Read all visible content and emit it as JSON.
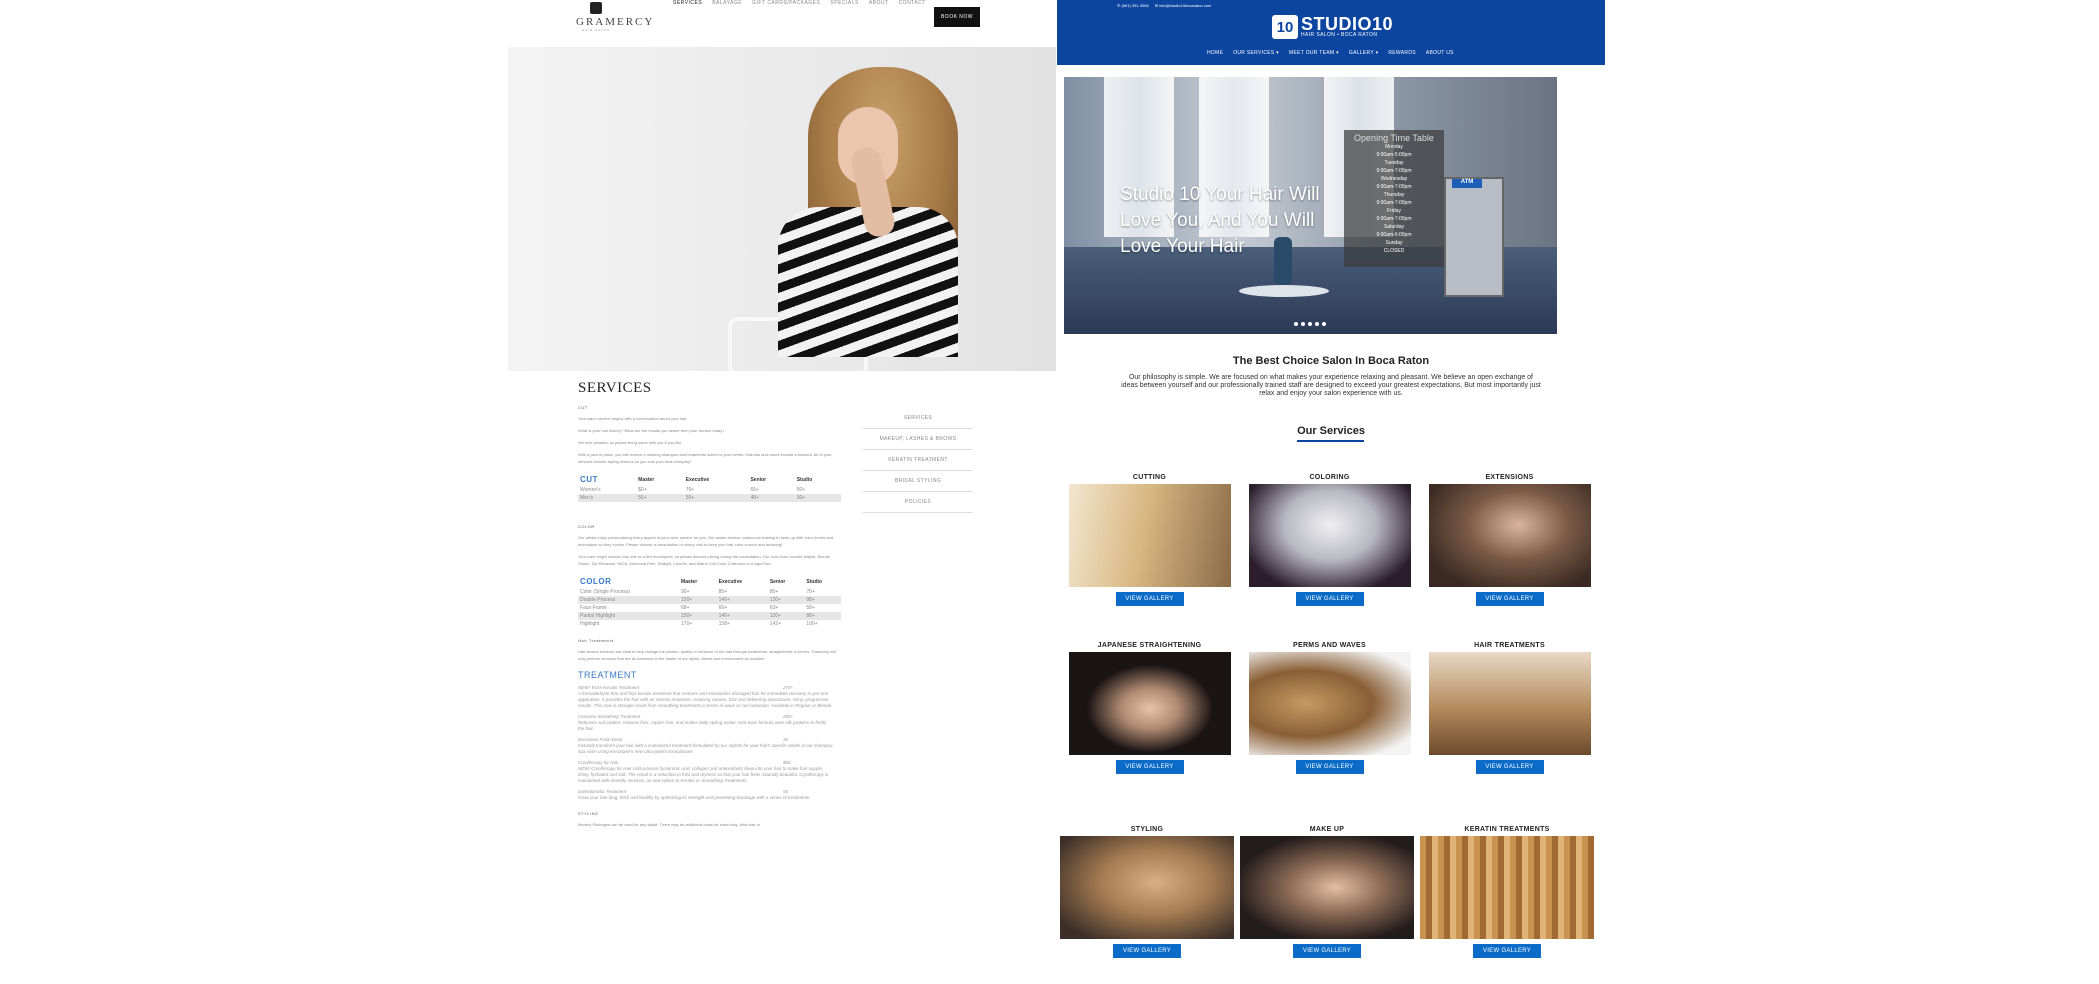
{
  "gramercy": {
    "logo_name": "GRAMERCY",
    "logo_sub": "HAIR SALON",
    "nav": [
      "SERVICES",
      "BALAYAGE",
      "GIFT CARDS/PACKAGES",
      "SPECIALS",
      "ABOUT",
      "CONTACT"
    ],
    "book_label": "BOOK NOW",
    "title": "SERVICES",
    "cut_heading": "CUT",
    "cut_paras": [
      "Your salon service begins with a conversation about your hair.",
      "What is your hair history? What are the results you desire from your service today?",
      "We love pictures, so please bring some with you if you like.",
      "With a plan in place, you will receive a relaxing shampoo and treatments suited to your needs. Haircuts and colors include a blowout. All of your services include styling lessons so you look your best everyday!"
    ],
    "cut_table": {
      "category": "CUT",
      "headers": [
        "Master",
        "Executive",
        "Senior",
        "Studio"
      ],
      "rows": [
        {
          "name": "Women's",
          "values": [
            "$0+",
            "75+",
            "65+",
            "50+"
          ]
        },
        {
          "name": "Men's",
          "values": [
            "55+",
            "50+",
            "48+",
            "30+"
          ]
        }
      ]
    },
    "color_heading": "COLOR",
    "color_paras": [
      "Our artists enjoy personalizing every aspect of your color service for you. Our artists receive continuous training to keep up with color trends and techniques so they evolve. Please choose a consultation on every visit to keep your hair color current and amazing!",
      "Your color might include only one or a few techniques, so please discuss pricing during the consultation. Our color lines include Majirel, Blonde Studio, Dia Richesse, INOA, Ammonia Free, Dialight, Colorfix, and Matrix Cult Color Collection or Kolga Pure."
    ],
    "color_table": {
      "category": "COLOR",
      "headers": [
        "Master",
        "Executive",
        "Senior",
        "Studio"
      ],
      "rows": [
        {
          "name": "Color (Single Process)",
          "values": [
            "90+",
            "85+",
            "80+",
            "70+"
          ]
        },
        {
          "name": "Double Process",
          "values": [
            "150+",
            "140+",
            "130+",
            "98+"
          ]
        },
        {
          "name": "Face Frame",
          "values": [
            "68+",
            "66+",
            "63+",
            "58+"
          ]
        },
        {
          "name": "Partial Highlight",
          "values": [
            "150+",
            "140+",
            "120+",
            "88+"
          ]
        },
        {
          "name": "Highlight",
          "values": [
            "170+",
            "158+",
            "142+",
            "100+"
          ]
        }
      ]
    },
    "treat_heading": "Hair Treatments",
    "treat_para": "Hair texture services are ideal to help change the pattern, quality or behavior of the hair through treatments, straighteners or perms. Gramercy will only perform services that are as harmless to the health of our stylist, clients and environment as possible.",
    "treat_title": "TREATMENT",
    "treatments": [
      {
        "name": "NEW! Truss Keratin Treatment",
        "price": "275+",
        "desc": "A formaldehyde free and frizz keratin treatment that restores and moisturizes damaged hair for immediate recovery in just one application. It provides the hair with an intense treatment, reducing volume, frizz and delivering spectacular, shiny, progressive results. This now is stronger result from smoothing treatments in terms of wave or curl reduction. Available in Regular or Blonde."
      },
      {
        "name": "Cezanne Smoothing Treatment",
        "price": "200+",
        "desc": "Releases curl pattern, reduces frizz, repairs hair, and makes daily styling easier. Non-toxic formula uses silk proteins to fortify the hair."
      },
      {
        "name": "Kerastase Fusio Dose",
        "price": "35",
        "desc": "Instantly transform your hair with a customized treatment formulated by our stylists for your hair's specific needs in our shampoo spa room using Kerastase's new ultra-potent formulations."
      },
      {
        "name": "Cryotherapy for Hair",
        "price": "$50",
        "desc": "NEW! Cryotherapy for Hair cold-process hyaluronic acid, collagen and antioxidants deep into your hair to make hair supple, shiny, hydrated and soft. The result is a reduction in frizz and dryness so that your hair feels naturally beautiful. Cryotherapy is maintained with monthly services, as new option to Keratin or Smoothing Treatments."
      },
      {
        "name": "Extentioncilia Treatment",
        "price": "55",
        "desc": "Grow your hair long, thick and healthy by optimizing its strength and preventing breakage with a series of treatments."
      }
    ],
    "styling_heading": "STYLING",
    "styling_para": "Beverly Packages can be used for any stylist. There may be additional costs for extra long, thick hair or",
    "sidebar": [
      "SERVICES",
      "MAKEUP, LASHES & BROWS",
      "KERATIN TREATMENT",
      "BRIDAL STYLING",
      "POLICIES"
    ]
  },
  "studio10": {
    "topbar_phone": "(561) 391-3960",
    "topbar_email": "info@studio10bocaraton.com",
    "logo_badge": "10",
    "logo_name": "STUDIO10",
    "logo_sub": "HAIR SALON • BOCA RATON",
    "nav": [
      "HOME",
      "OUR SERVICES ▾",
      "MEET OUR TEAM ▾",
      "GALLERY ▾",
      "REWARDS",
      "ABOUT US"
    ],
    "slider_tagline": "Studio 10 Your Hair Will Love You, And You Will Love Your Hair",
    "atm_sign": "ATM",
    "timetable": {
      "title": "Opening Time Table",
      "lines": [
        "Monday",
        "9:00am-5:00pm",
        "Tuesday",
        "9:00am-7:00pm",
        "Wednesday",
        "9:00am-7:00pm",
        "Thursday",
        "9:00am-7:00pm",
        "Friday",
        "9:00am-7:00pm",
        "Saturday",
        "9:00am-6:00pm",
        "Sunday",
        "CLOSED"
      ]
    },
    "best_title": "The Best Choice Salon In Boca Raton",
    "philosophy": "Our philosophy is simple. We are focused on what makes your experience relaxing and pleasant. We believe an open exchange of ideas between yourself and our professionally trained staff are designed to exceed your greatest expectations, But most importantly just relax and enjoy your salon experience with us.",
    "services_title": "Our Services",
    "button_label": "VIEW GALLERY",
    "services": [
      "CUTTING",
      "COLORING",
      "EXTENSIONS",
      "JAPANESE STRAIGHTENING",
      "PERMS AND WAVES",
      "HAIR TREATMENTS",
      "STYLING",
      "MAKE UP",
      "KERATIN TREATMENTS"
    ]
  },
  "colors": {
    "studio_blue": "#0b45a0",
    "button_blue": "#0b6bc8",
    "gramercy_accent": "#3a7bc8"
  }
}
